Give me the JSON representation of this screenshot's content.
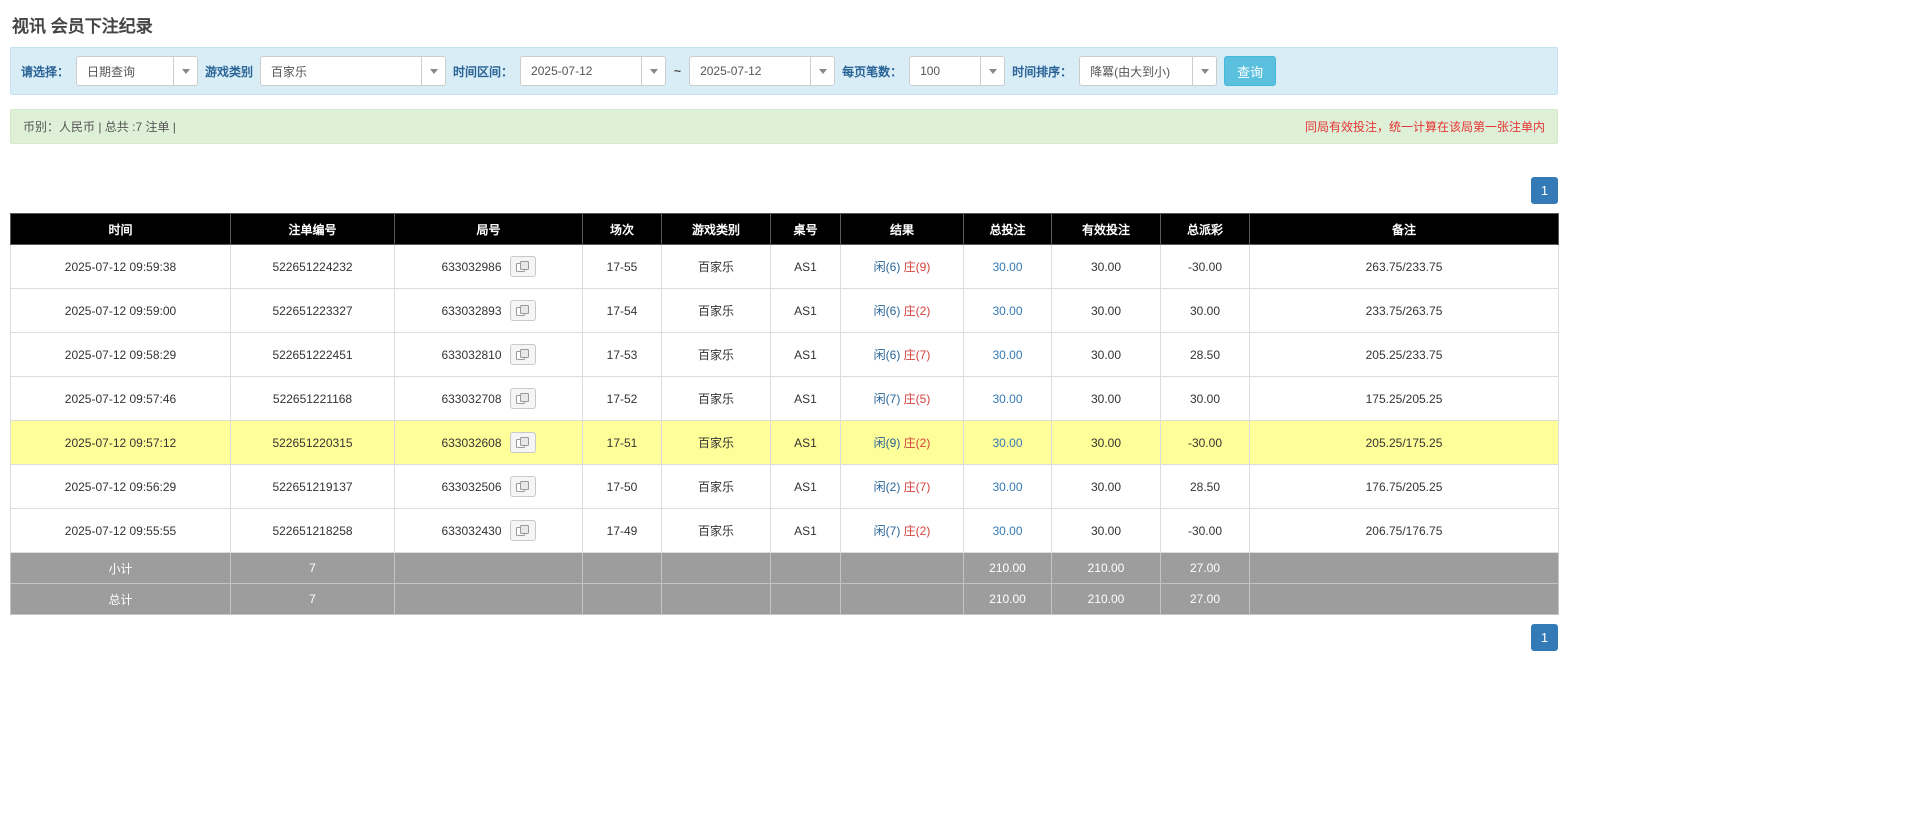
{
  "page": {
    "title": "视讯 会员下注纪录"
  },
  "filters": {
    "select_label": "请选择：",
    "select_value": "日期查询",
    "game_type_label": "游戏类别",
    "game_type_value": "百家乐",
    "date_range_label": "时间区间：",
    "date_from": "2025-07-12",
    "date_tilde": "~",
    "date_to": "2025-07-12",
    "page_size_label": "每页笔数：",
    "page_size_value": "100",
    "sort_label": "时间排序：",
    "sort_value": "降冪(由大到小)",
    "search_button": "查询"
  },
  "summary": {
    "left": "币别：人民币 | 总共 :7 注单 |",
    "right": "同局有效投注，统一计算在该局第一张注单内"
  },
  "pagination": {
    "page": "1"
  },
  "icons": {
    "dropdown_caret": "caret-down",
    "view_cards": "cards-image-button"
  },
  "colors": {
    "accent_blue": "#337ab7",
    "info_button": "#5bc0de",
    "highlight_row": "#ffff99",
    "negative": "#e53333",
    "player_blue": "#2a6496",
    "banker_red": "#d43f3a"
  },
  "table": {
    "headers": [
      "时间",
      "注单编号",
      "局号",
      "场次",
      "游戏类别",
      "桌号",
      "结果",
      "总投注",
      "有效投注",
      "总派彩",
      "备注"
    ],
    "rows": [
      {
        "time": "2025-07-12 09:59:38",
        "bet_id": "522651224232",
        "round": "633032986",
        "session": "17-55",
        "game": "百家乐",
        "table_no": "AS1",
        "result_player": "闲(6)",
        "result_banker": "庄(9)",
        "total_bet": "30.00",
        "valid_bet": "30.00",
        "payout": "-30.00",
        "remark": "263.75/233.75",
        "highlight": false
      },
      {
        "time": "2025-07-12 09:59:00",
        "bet_id": "522651223327",
        "round": "633032893",
        "session": "17-54",
        "game": "百家乐",
        "table_no": "AS1",
        "result_player": "闲(6)",
        "result_banker": "庄(2)",
        "total_bet": "30.00",
        "valid_bet": "30.00",
        "payout": "30.00",
        "remark": "233.75/263.75",
        "highlight": false
      },
      {
        "time": "2025-07-12 09:58:29",
        "bet_id": "522651222451",
        "round": "633032810",
        "session": "17-53",
        "game": "百家乐",
        "table_no": "AS1",
        "result_player": "闲(6)",
        "result_banker": "庄(7)",
        "total_bet": "30.00",
        "valid_bet": "30.00",
        "payout": "28.50",
        "remark": "205.25/233.75",
        "highlight": false
      },
      {
        "time": "2025-07-12 09:57:46",
        "bet_id": "522651221168",
        "round": "633032708",
        "session": "17-52",
        "game": "百家乐",
        "table_no": "AS1",
        "result_player": "闲(7)",
        "result_banker": "庄(5)",
        "total_bet": "30.00",
        "valid_bet": "30.00",
        "payout": "30.00",
        "remark": "175.25/205.25",
        "highlight": false
      },
      {
        "time": "2025-07-12 09:57:12",
        "bet_id": "522651220315",
        "round": "633032608",
        "session": "17-51",
        "game": "百家乐",
        "table_no": "AS1",
        "result_player": "闲(9)",
        "result_banker": "庄(2)",
        "total_bet": "30.00",
        "valid_bet": "30.00",
        "payout": "-30.00",
        "remark": "205.25/175.25",
        "highlight": true
      },
      {
        "time": "2025-07-12 09:56:29",
        "bet_id": "522651219137",
        "round": "633032506",
        "session": "17-50",
        "game": "百家乐",
        "table_no": "AS1",
        "result_player": "闲(2)",
        "result_banker": "庄(7)",
        "total_bet": "30.00",
        "valid_bet": "30.00",
        "payout": "28.50",
        "remark": "176.75/205.25",
        "highlight": false
      },
      {
        "time": "2025-07-12 09:55:55",
        "bet_id": "522651218258",
        "round": "633032430",
        "session": "17-49",
        "game": "百家乐",
        "table_no": "AS1",
        "result_player": "闲(7)",
        "result_banker": "庄(2)",
        "total_bet": "30.00",
        "valid_bet": "30.00",
        "payout": "-30.00",
        "remark": "206.75/176.75",
        "highlight": false
      }
    ],
    "footer": [
      {
        "label": "小计",
        "count": "7",
        "total_bet": "210.00",
        "valid_bet": "210.00",
        "payout": "27.00"
      },
      {
        "label": "总计",
        "count": "7",
        "total_bet": "210.00",
        "valid_bet": "210.00",
        "payout": "27.00"
      }
    ]
  }
}
